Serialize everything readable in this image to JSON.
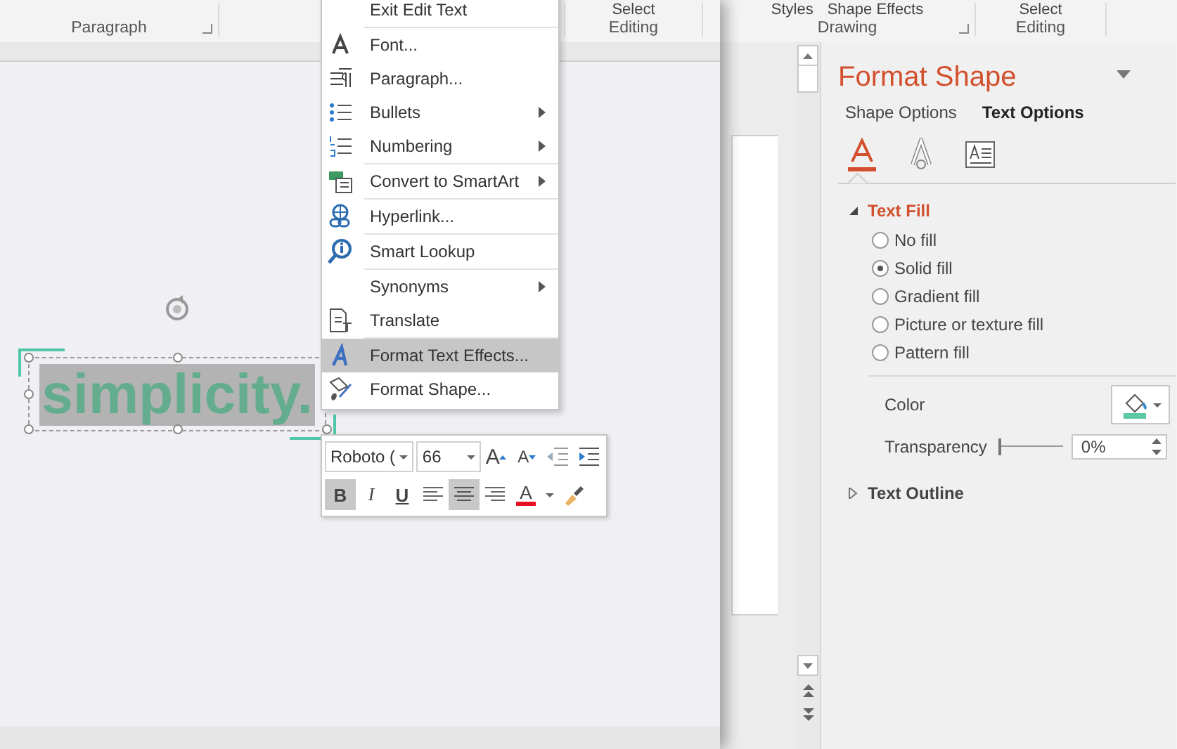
{
  "ribbon": {
    "groups": [
      {
        "label": "Paragraph",
        "launcher": true
      },
      {
        "label": "Editing",
        "launcher": false,
        "commands": [
          "Select"
        ]
      },
      {
        "label": "Drawing",
        "launcher": true,
        "commands": [
          "Styles",
          "Shape Effects"
        ]
      },
      {
        "label": "Editing",
        "launcher": false,
        "commands": [
          "Select"
        ]
      }
    ]
  },
  "slide": {
    "text": "simplicity.",
    "selected": true
  },
  "context_menu": {
    "groups": [
      [
        {
          "label": "Exit Edit Text",
          "submenu": false,
          "highlighted": false
        }
      ],
      [
        {
          "label": "Font...",
          "submenu": false,
          "highlighted": false
        },
        {
          "label": "Paragraph...",
          "submenu": false,
          "highlighted": false
        },
        {
          "label": "Bullets",
          "submenu": true,
          "highlighted": false
        },
        {
          "label": "Numbering",
          "submenu": true,
          "highlighted": false
        }
      ],
      [
        {
          "label": "Convert to SmartArt",
          "submenu": true,
          "highlighted": false
        }
      ],
      [
        {
          "label": "Hyperlink...",
          "submenu": false,
          "highlighted": false
        }
      ],
      [
        {
          "label": "Smart Lookup",
          "submenu": false,
          "highlighted": false
        }
      ],
      [
        {
          "label": "Synonyms",
          "submenu": true,
          "highlighted": false
        },
        {
          "label": "Translate",
          "submenu": false,
          "highlighted": false
        }
      ],
      [
        {
          "label": "Format Text Effects...",
          "submenu": false,
          "highlighted": true
        },
        {
          "label": "Format Shape...",
          "submenu": false,
          "highlighted": false
        }
      ]
    ]
  },
  "mini_toolbar": {
    "font": "Roboto (",
    "size": "66",
    "row_1": [
      {
        "kind": "grow",
        "label": "A"
      },
      {
        "kind": "shrink",
        "label": "A"
      },
      {
        "kind": "outdent"
      },
      {
        "kind": "indent"
      }
    ],
    "row_2": [
      {
        "kind": "bold",
        "label": "B",
        "selected": true
      },
      {
        "kind": "italic",
        "label": "I",
        "selected": false
      },
      {
        "kind": "underline",
        "label": "U",
        "selected": false
      },
      {
        "kind": "align-left",
        "selected": false
      },
      {
        "kind": "align-center",
        "selected": true
      },
      {
        "kind": "align-right",
        "selected": false
      },
      {
        "kind": "font-color",
        "label": "A"
      },
      {
        "kind": "painter"
      }
    ]
  },
  "pane": {
    "title": "Format Shape",
    "tabs": [
      {
        "label": "Shape Options",
        "selected": false
      },
      {
        "label": "Text Options",
        "selected": true
      }
    ],
    "icon_tabs": [
      {
        "kind": "fill",
        "selected": true
      },
      {
        "kind": "outline",
        "selected": false
      },
      {
        "kind": "textbox",
        "selected": false
      }
    ],
    "sections": [
      {
        "title": "Text Fill",
        "expanded": true,
        "options": [
          {
            "label": "No fill",
            "selected": false
          },
          {
            "label": "Solid fill",
            "selected": true
          },
          {
            "label": "Gradient fill",
            "selected": false
          },
          {
            "label": "Picture or texture fill",
            "selected": false
          },
          {
            "label": "Pattern fill",
            "selected": false
          }
        ],
        "color_label": "Color",
        "transparency": {
          "label": "Transparency",
          "level": 0,
          "value": "0%"
        }
      },
      {
        "title": "Text Outline",
        "expanded": false
      }
    ]
  }
}
